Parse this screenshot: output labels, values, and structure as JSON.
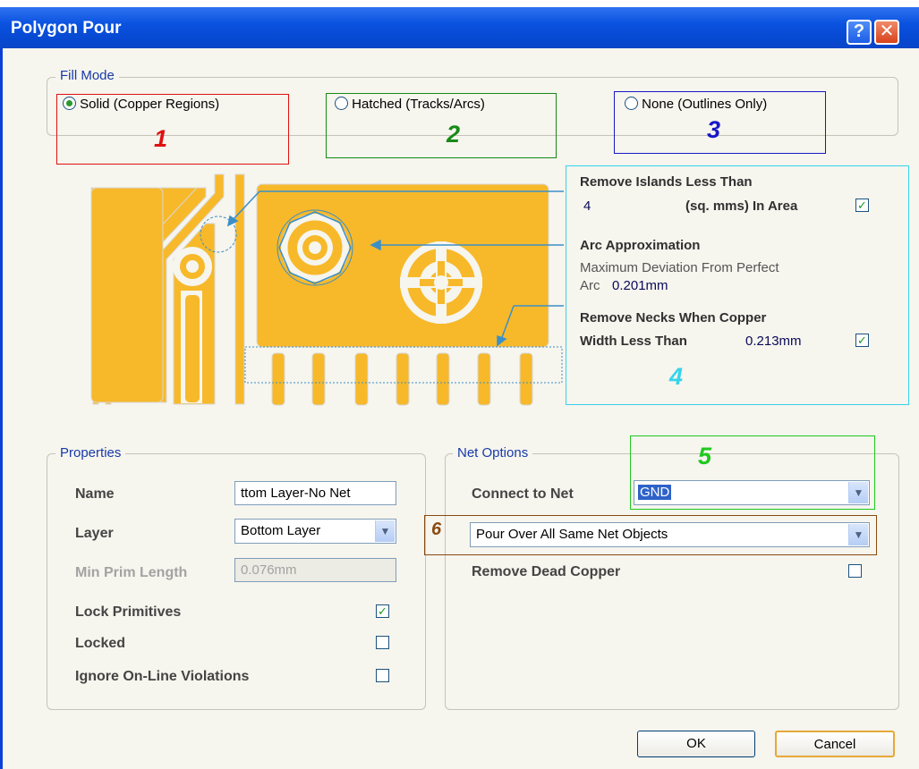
{
  "window": {
    "title": "Polygon Pour"
  },
  "titlebar": {
    "help": "?",
    "close": "✕"
  },
  "fill_mode": {
    "label": "Fill Mode",
    "options": [
      {
        "label": "Solid (Copper Regions)",
        "selected": true,
        "marker": "1",
        "marker_color": "#e01010"
      },
      {
        "label": "Hatched (Tracks/Arcs)",
        "selected": false,
        "marker": "2",
        "marker_color": "#178a17"
      },
      {
        "label": "None (Outlines Only)",
        "selected": false,
        "marker": "3",
        "marker_color": "#1818c8"
      }
    ]
  },
  "preview": {
    "remove_islands": {
      "heading": "Remove Islands Less Than",
      "value": "4",
      "unit": "(sq. mms) In Area",
      "checked": true
    },
    "arc_approx": {
      "heading": "Arc Approximation",
      "desc": "Maximum Deviation From Perfect",
      "arc_label": "Arc",
      "value": "0.201mm"
    },
    "remove_necks": {
      "heading": "Remove Necks When Copper",
      "label": "Width Less Than",
      "value": "0.213mm",
      "checked": true
    },
    "marker": "4",
    "marker_color": "#35d4ec",
    "copper_color": "#f7b92a"
  },
  "properties": {
    "label": "Properties",
    "name_label": "Name",
    "name_value": "ttom Layer-No Net",
    "layer_label": "Layer",
    "layer_value": "Bottom Layer",
    "min_prim_label": "Min Prim Length",
    "min_prim_value": "0.076mm",
    "lock_primitives_label": "Lock Primitives",
    "lock_primitives_checked": true,
    "locked_label": "Locked",
    "locked_checked": false,
    "ignore_label": "Ignore On-Line Violations",
    "ignore_checked": false
  },
  "net_options": {
    "label": "Net Options",
    "connect_label": "Connect to Net",
    "connect_value": "GND",
    "pour_value": "Pour Over All Same Net Objects",
    "remove_dead_label": "Remove Dead Copper",
    "remove_dead_checked": false,
    "marker5": "5",
    "marker5_color": "#1fc91f",
    "marker6": "6",
    "marker6_color": "#8a4a10"
  },
  "buttons": {
    "ok": "OK",
    "cancel": "Cancel"
  }
}
